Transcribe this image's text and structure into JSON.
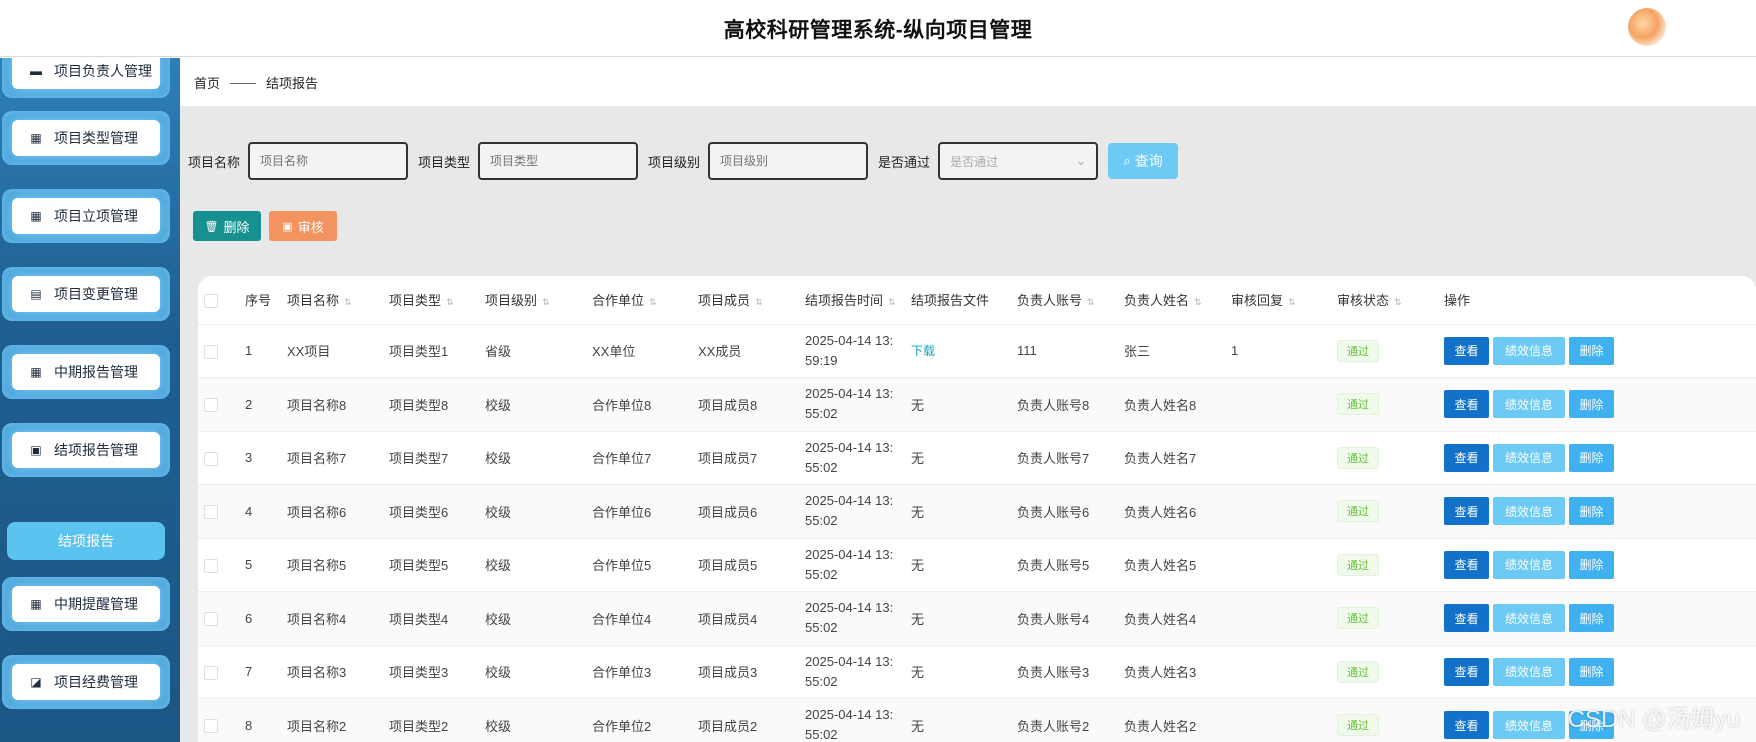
{
  "header": {
    "title": "高校科研管理系统-纵向项目管理"
  },
  "sidebar": {
    "items": [
      {
        "label": "项目负责人管理",
        "icon": "monitor-icon",
        "glyph": "▬"
      },
      {
        "label": "项目类型管理",
        "icon": "grid-icon",
        "glyph": "▦"
      },
      {
        "label": "项目立项管理",
        "icon": "grid-icon",
        "glyph": "▦"
      },
      {
        "label": "项目变更管理",
        "icon": "clipboard-icon",
        "glyph": "▤"
      },
      {
        "label": "中期报告管理",
        "icon": "grid-icon",
        "glyph": "▦"
      },
      {
        "label": "结项报告管理",
        "icon": "clipboard-check-icon",
        "glyph": "▣"
      },
      {
        "label": "中期提醒管理",
        "icon": "grid-icon",
        "glyph": "▦"
      },
      {
        "label": "项目经费管理",
        "icon": "chart-icon",
        "glyph": "◪"
      }
    ],
    "active_sub": "结项报告"
  },
  "breadcrumb": {
    "home": "首页",
    "separator": "——",
    "current": "结项报告"
  },
  "filters": {
    "name": {
      "label": "项目名称",
      "placeholder": "项目名称"
    },
    "type": {
      "label": "项目类型",
      "placeholder": "项目类型"
    },
    "level": {
      "label": "项目级别",
      "placeholder": "项目级别"
    },
    "pass": {
      "label": "是否通过",
      "placeholder": "是否通过"
    },
    "search_label": "查询"
  },
  "actions": {
    "delete_label": "删除",
    "audit_label": "审核"
  },
  "table": {
    "headers": [
      "序号",
      "项目名称",
      "项目类型",
      "项目级别",
      "合作单位",
      "项目成员",
      "结项报告时间",
      "结项报告文件",
      "负责人账号",
      "负责人姓名",
      "审核回复",
      "审核状态",
      "操作"
    ],
    "rows": [
      {
        "no": "1",
        "name": "XX项目",
        "type": "项目类型1",
        "level": "省级",
        "unit": "XX单位",
        "member": "XX成员",
        "time1": "2025-04-14 13:",
        "time2": "59:19",
        "file": "下载",
        "account": "111",
        "person": "张三",
        "reply": "1",
        "status": "通过"
      },
      {
        "no": "2",
        "name": "项目名称8",
        "type": "项目类型8",
        "level": "校级",
        "unit": "合作单位8",
        "member": "项目成员8",
        "time1": "2025-04-14 13:",
        "time2": "55:02",
        "file": "无",
        "account": "负责人账号8",
        "person": "负责人姓名8",
        "reply": "",
        "status": "通过"
      },
      {
        "no": "3",
        "name": "项目名称7",
        "type": "项目类型7",
        "level": "校级",
        "unit": "合作单位7",
        "member": "项目成员7",
        "time1": "2025-04-14 13:",
        "time2": "55:02",
        "file": "无",
        "account": "负责人账号7",
        "person": "负责人姓名7",
        "reply": "",
        "status": "通过"
      },
      {
        "no": "4",
        "name": "项目名称6",
        "type": "项目类型6",
        "level": "校级",
        "unit": "合作单位6",
        "member": "项目成员6",
        "time1": "2025-04-14 13:",
        "time2": "55:02",
        "file": "无",
        "account": "负责人账号6",
        "person": "负责人姓名6",
        "reply": "",
        "status": "通过"
      },
      {
        "no": "5",
        "name": "项目名称5",
        "type": "项目类型5",
        "level": "校级",
        "unit": "合作单位5",
        "member": "项目成员5",
        "time1": "2025-04-14 13:",
        "time2": "55:02",
        "file": "无",
        "account": "负责人账号5",
        "person": "负责人姓名5",
        "reply": "",
        "status": "通过"
      },
      {
        "no": "6",
        "name": "项目名称4",
        "type": "项目类型4",
        "level": "校级",
        "unit": "合作单位4",
        "member": "项目成员4",
        "time1": "2025-04-14 13:",
        "time2": "55:02",
        "file": "无",
        "account": "负责人账号4",
        "person": "负责人姓名4",
        "reply": "",
        "status": "通过"
      },
      {
        "no": "7",
        "name": "项目名称3",
        "type": "项目类型3",
        "level": "校级",
        "unit": "合作单位3",
        "member": "项目成员3",
        "time1": "2025-04-14 13:",
        "time2": "55:02",
        "file": "无",
        "account": "负责人账号3",
        "person": "负责人姓名3",
        "reply": "",
        "status": "通过"
      },
      {
        "no": "8",
        "name": "项目名称2",
        "type": "项目类型2",
        "level": "校级",
        "unit": "合作单位2",
        "member": "项目成员2",
        "time1": "2025-04-14 13:",
        "time2": "55:02",
        "file": "无",
        "account": "负责人账号2",
        "person": "负责人姓名2",
        "reply": "",
        "status": "通过"
      }
    ],
    "op_labels": {
      "view": "查看",
      "perf": "绩效信息",
      "remove": "删除"
    }
  },
  "watermark": "CSDN @汤姆yu"
}
